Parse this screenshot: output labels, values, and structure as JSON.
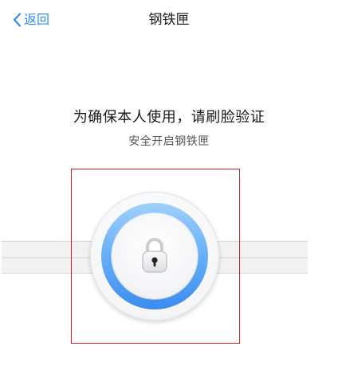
{
  "navbar": {
    "back_label": "返回",
    "title": "钢铁匣"
  },
  "content": {
    "heading": "为确保本人使用，请刷脸验证",
    "subheading": "安全开启钢铁匣"
  },
  "colors": {
    "accent": "#2f8df4",
    "frame": "#d71f26",
    "ring_top": "#9fd0fb",
    "ring_bottom": "#3b8cf0"
  },
  "icons": {
    "back": "chevron-left-icon",
    "lock": "padlock-icon"
  }
}
